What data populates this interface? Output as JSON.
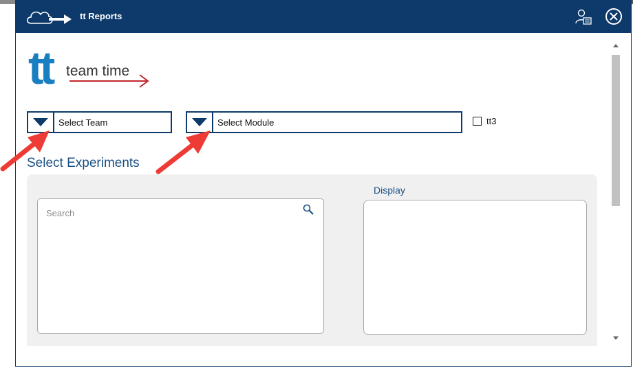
{
  "window": {
    "title": "tt Reports"
  },
  "logo": {
    "letters": "tt",
    "text": "team time"
  },
  "filters": {
    "team_label": "Select Team",
    "module_label": "Select Module",
    "checkbox_label": "tt3",
    "checkbox_checked": false
  },
  "experiments": {
    "title": "Select Experiments",
    "search_placeholder": "Search",
    "display_label": "Display"
  },
  "colors": {
    "titlebar": "#0d3a6a",
    "logo_blue": "#1a7fc1",
    "arrow_red": "#c1272d",
    "annotation_red": "#ef3b35"
  },
  "icons": [
    "cloud-arrow-icon",
    "user-card-icon",
    "close-icon",
    "dropdown-triangle-icon",
    "search-icon"
  ]
}
